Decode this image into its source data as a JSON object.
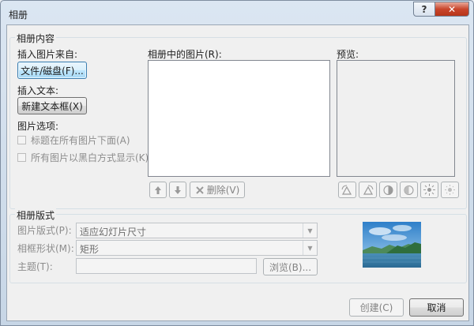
{
  "window": {
    "title": "相册",
    "help_glyph": "?",
    "close_glyph": "✕"
  },
  "content_group": {
    "label": "相册内容",
    "insert_picture_from": "插入图片来自:",
    "file_disk_button": "文件/磁盘(F)...",
    "insert_text": "插入文本:",
    "new_textbox_button": "新建文本框(X)",
    "picture_options": "图片选项:",
    "caption_below": "标题在所有图片下面(A)",
    "all_black_white": "所有图片以黑白方式显示(K)",
    "pictures_in_album": "相册中的图片(R):",
    "preview": "预览:",
    "delete_button": "删除(V)"
  },
  "layout_group": {
    "label": "相册版式",
    "picture_layout_label": "图片版式(P):",
    "picture_layout_value": "适应幻灯片尺寸",
    "frame_shape_label": "相框形状(M):",
    "frame_shape_value": "矩形",
    "theme_label": "主题(T):",
    "browse_button": "浏览(B)..."
  },
  "footer": {
    "create_button": "创建(C)",
    "cancel_button": "取消"
  },
  "icons": {
    "move_up": "arrow-up-icon",
    "move_down": "arrow-down-icon",
    "delete": "delete-x-icon",
    "rotate_left": "rotate-left-icon",
    "rotate_right": "rotate-right-icon",
    "contrast_up": "contrast-increase-icon",
    "contrast_down": "contrast-decrease-icon",
    "brightness_up": "brightness-increase-icon",
    "brightness_down": "brightness-decrease-icon"
  },
  "colors": {
    "accent": "#3c7fb1",
    "close": "#c9462c"
  }
}
